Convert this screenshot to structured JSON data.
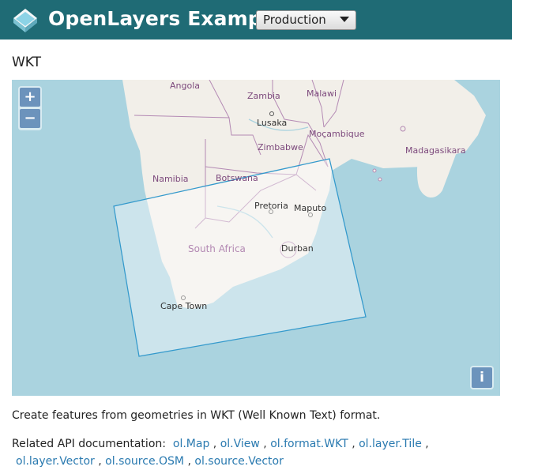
{
  "header": {
    "brand": "OpenLayers Examples",
    "version_selected": "Production",
    "colors": {
      "navbar": "#1f6b75",
      "brand_text": "#ffffff"
    }
  },
  "page": {
    "title": "WKT"
  },
  "map": {
    "controls": {
      "zoom_in": "+",
      "zoom_out": "−",
      "attribution": "i"
    },
    "labels": {
      "angola": "Angola",
      "zambia": "Zambia",
      "malawi": "Malawi",
      "lusaka": "Lusaka",
      "mocambique": "Moçambique",
      "zimbabwe": "Zimbabwe",
      "madagasikara": "Madagasikara",
      "namibia": "Namibia",
      "botswana": "Botswana",
      "pretoria": "Pretoria",
      "maputo": "Maputo",
      "south_africa": "South Africa",
      "durban": "Durban",
      "cape_town": "Cape Town"
    },
    "colors": {
      "ocean": "#aad3df",
      "land": "#f2efe9",
      "polygon_stroke": "#3399cc",
      "polygon_fill": "rgba(255,255,255,0.4)"
    }
  },
  "description": "Create features from geometries in WKT (Well Known Text) format.",
  "related": {
    "prefix": "Related API documentation:",
    "links": [
      "ol.Map",
      "ol.View",
      "ol.format.WKT",
      "ol.layer.Tile",
      "ol.layer.Vector",
      "ol.source.OSM",
      "ol.source.Vector"
    ],
    "separator": ","
  }
}
